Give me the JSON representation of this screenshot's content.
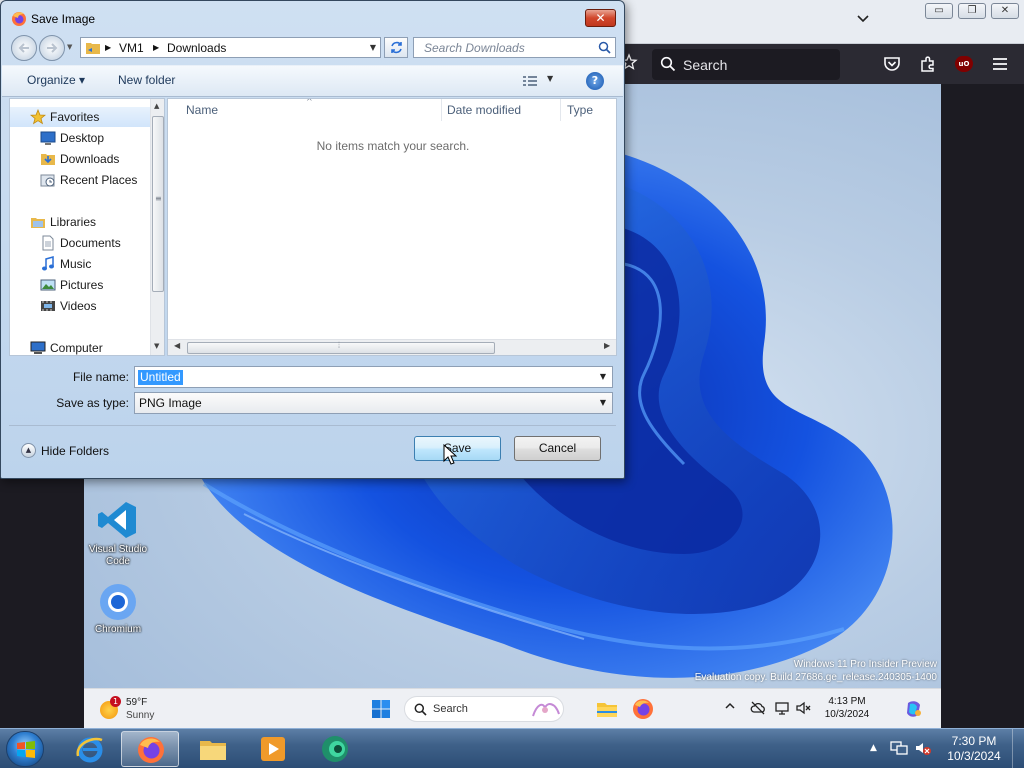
{
  "browser": {
    "search_label": "Search",
    "window_controls": [
      "minimize-icon",
      "restore-icon",
      "close-icon"
    ]
  },
  "dialog": {
    "title": "Save Image",
    "close_label": "✕",
    "breadcrumb": [
      "VM1",
      "Downloads"
    ],
    "search_placeholder": "Search Downloads",
    "organize_label": "Organize ▾",
    "new_folder_label": "New folder",
    "help_label": "?",
    "nav": {
      "favorites": "Favorites",
      "desktop": "Desktop",
      "downloads": "Downloads",
      "recent_places": "Recent Places",
      "libraries": "Libraries",
      "documents": "Documents",
      "music": "Music",
      "pictures": "Pictures",
      "videos": "Videos",
      "computer": "Computer"
    },
    "columns": {
      "name": "Name",
      "date_modified": "Date modified",
      "type": "Type"
    },
    "empty_message": "No items match your search.",
    "file_name_label": "File name:",
    "file_name_value": "Untitled",
    "save_as_type_label": "Save as type:",
    "save_as_type_value": "PNG Image",
    "hide_folders_label": "Hide Folders",
    "save_label": "Save",
    "cancel_label": "Cancel",
    "accent_color": "#3399ff"
  },
  "vm": {
    "desktop_icons": {
      "vscode": "Visual Studio Code",
      "chromium": "Chromium"
    },
    "watermark_line1": "Windows 11 Pro Insider Preview",
    "watermark_line2": "Evaluation copy. Build 27686.ge_release.240305-1400",
    "weather_temp": "59°F",
    "weather_cond": "Sunny",
    "weather_badge": "1",
    "search_label": "Search",
    "clock_time": "4:13 PM",
    "clock_date": "10/3/2024"
  },
  "host": {
    "clock_time": "7:30 PM",
    "clock_date": "10/3/2024"
  }
}
